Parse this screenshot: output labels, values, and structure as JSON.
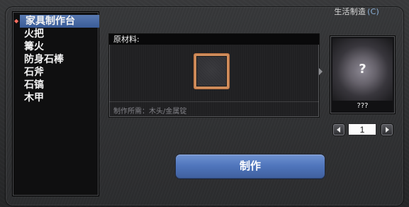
{
  "window": {
    "top_title_text": "生活制造",
    "top_title_hotkey": "(C)"
  },
  "recipes": {
    "selected_index": 0,
    "items": [
      {
        "label": "家具制作台"
      },
      {
        "label": "火把"
      },
      {
        "label": "篝火"
      },
      {
        "label": "防身石棒"
      },
      {
        "label": "石斧"
      },
      {
        "label": "石镐"
      },
      {
        "label": "木甲"
      }
    ]
  },
  "materials": {
    "header": "原材料:",
    "requirement": "制作所需：木头/金属锭"
  },
  "preview": {
    "placeholder_symbol": "?",
    "name": "???"
  },
  "quantity": {
    "value": "1"
  },
  "actions": {
    "craft_label": "制作"
  },
  "colors": {
    "accent": "#4f73b8",
    "selected_row": "#4e6fae",
    "slot_border": "#d08d5c",
    "text_primary": "#f2f2f2",
    "text_muted": "#838389"
  },
  "icons": {
    "selection_marker": "selection-marker-icon",
    "arrow_right": "arrow-right-icon",
    "quantity_decrease": "arrow-left-icon",
    "quantity_increase": "arrow-right-icon"
  }
}
